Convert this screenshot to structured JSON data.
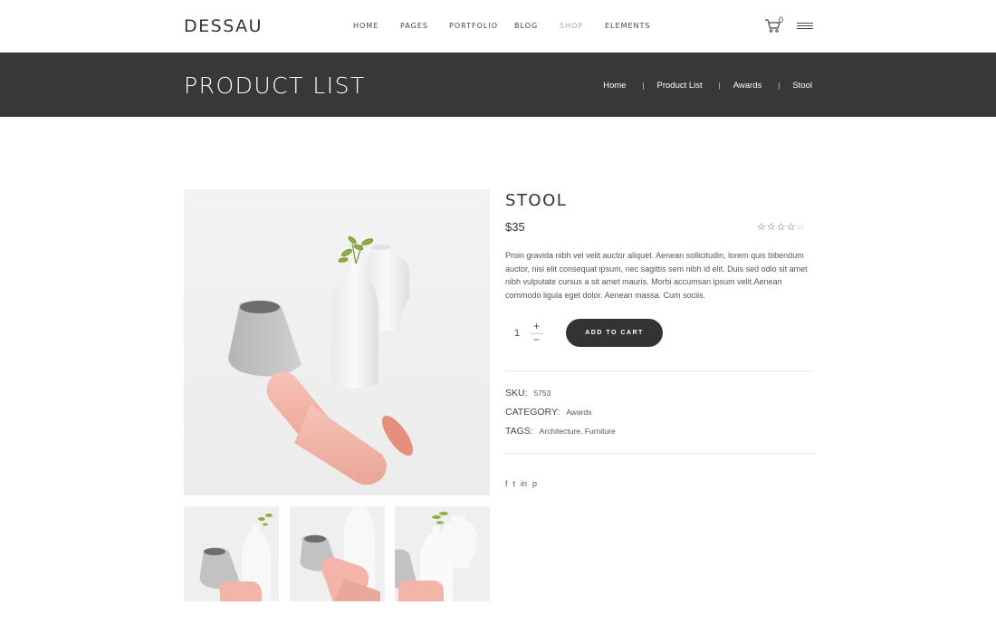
{
  "header": {
    "logo": "DESSAU",
    "nav": [
      {
        "label": "HOME",
        "active": false
      },
      {
        "label": "PAGES",
        "active": false
      },
      {
        "label": "PORTFOLIO",
        "active": false
      },
      {
        "label": "BLOG",
        "active": false
      },
      {
        "label": "SHOP",
        "active": true
      },
      {
        "label": "ELEMENTS",
        "active": false
      }
    ],
    "cart_count": "0"
  },
  "band": {
    "title": "PRODUCT LIST",
    "breadcrumbs": [
      "Home",
      "Product List",
      "Awards",
      "Stool"
    ]
  },
  "product": {
    "title": "STOOL",
    "price": "$35",
    "rating": 4,
    "rating_max": 5,
    "description": "Proin gravida nibh vel velit auctor aliquet. Aenean sollicitudin, lorem quis bibendum auctor, nisi elit consequat ipsum, nec sagittis sem nibh id elit. Duis sed odio sit amet nibh vulputate cursus a sit amet mauris. Morbi accumsan ipsum velit.Aenean commodo ligula eget dolor. Aenean massa. Cum sociis.",
    "quantity": "1",
    "add_to_cart": "ADD TO CART",
    "sku_label": "SKU:",
    "sku": "5753",
    "category_label": "CATEGORY:",
    "category": "Awards",
    "tags_label": "TAGS:",
    "tags": "Architecture, Furniture"
  },
  "social": [
    "f",
    "t",
    "in",
    "p"
  ],
  "colors": {
    "band": "#383838",
    "button": "#333333",
    "pink": "#f3b5aa",
    "grey_vase": "#bdbdbd"
  }
}
